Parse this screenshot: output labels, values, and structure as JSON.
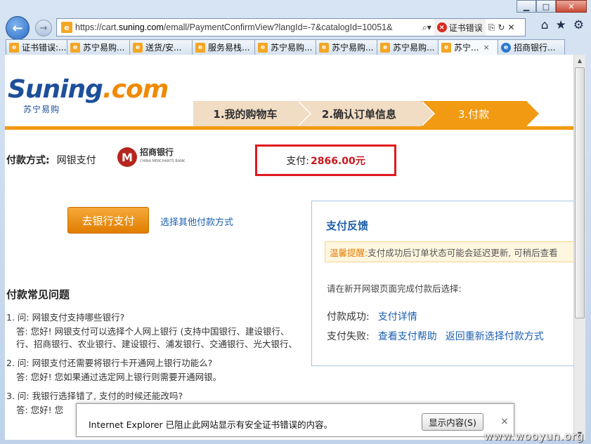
{
  "browser": {
    "address_url_prefix": "https://cart.",
    "address_url_domain": "suning.com",
    "address_url_rest": "/emall/PaymentConfirmView?langId=-7&catalogId=10051&",
    "cert_error_label": "证书错误",
    "caption": {
      "min": "▁",
      "max": "□",
      "close": "✕"
    },
    "tabs": [
      {
        "label": "证书错误:...",
        "icon": "e",
        "active": false
      },
      {
        "label": "苏宁易购...",
        "icon": "e",
        "active": false
      },
      {
        "label": "送货/安...",
        "icon": "e",
        "active": false
      },
      {
        "label": "服务易栈...",
        "icon": "e",
        "active": false
      },
      {
        "label": "苏宁易购...",
        "icon": "e",
        "active": false
      },
      {
        "label": "苏宁易购...",
        "icon": "e",
        "active": false
      },
      {
        "label": "苏宁易购...",
        "icon": "e",
        "active": false
      },
      {
        "label": "苏宁...",
        "icon": "e",
        "active": true
      },
      {
        "label": "招商银行...",
        "icon": "ie",
        "active": false
      }
    ]
  },
  "page": {
    "logo": {
      "brand": "Suning",
      "dot": ".",
      "tld": "com",
      "sub": "苏宁易购"
    },
    "steps": [
      "1.我的购物车",
      "2.确认订单信息",
      "3.付款"
    ],
    "pay_method_label": "付款方式:",
    "pay_method_value": "网银支付",
    "bank": {
      "mark": "M",
      "name": "招商银行",
      "name_en": "CHINA MERCHANTS BANK"
    },
    "amount_label": "支付:",
    "amount_value": "2866.00元",
    "bank_pay_button": "去银行支付",
    "other_method_link": "选择其他付款方式",
    "faq_title": "付款常见问题",
    "faq": [
      {
        "q": "1. 问: 网银支付支持哪些银行?",
        "a": [
          "答: 您好! 网银支付可以选择个人网上银行 (支持中国银行、建设银行、",
          "行、招商银行、农业银行、建设银行、浦发银行、交通银行、光大银行、"
        ]
      },
      {
        "q": "2. 问: 网银支付还需要将银行卡开通网上银行功能么?",
        "a": [
          "答: 您好! 您如果通过选定网上银行则需要开通网银。"
        ]
      },
      {
        "q": "3. 问: 我银行选择错了, 支付的时候还能改吗?",
        "a": [
          "答: 您好! 您"
        ]
      }
    ],
    "feedback": {
      "title": "支付反馈",
      "tip_label": "温馨提醒:",
      "tip_text": "支付成功后订单状态可能会延迟更新, 可稍后查看",
      "prompt": "请在新开网银页面完成付款后选择:",
      "success_label": "付款成功:",
      "success_link": "支付详情",
      "fail_label": "支付失败:",
      "fail_link_help": "查看支付帮助",
      "fail_link_back": "返回重新选择付款方式"
    }
  },
  "notification": {
    "text": "Internet Explorer 已阻止此网站显示有安全证书错误的内容。",
    "button": "显示内容(S)",
    "close": "×"
  },
  "watermark": "www.wooyun.org"
}
